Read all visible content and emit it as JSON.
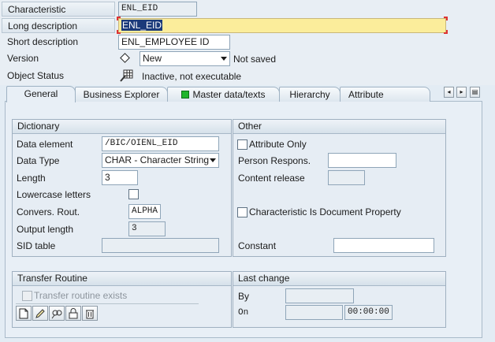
{
  "header": {
    "characteristic": {
      "label": "Characteristic",
      "value": "ENL_EID"
    },
    "long_description": {
      "label": "Long description",
      "value": "ENL_EID"
    },
    "short_description": {
      "label": "Short description",
      "value": "ENL_EMPLOYEE ID"
    },
    "version": {
      "label": "Version",
      "value": "New",
      "status": "Not saved"
    },
    "object_status": {
      "label": "Object Status",
      "value": "Inactive, not executable"
    }
  },
  "tabs": [
    {
      "label": "General",
      "active": true
    },
    {
      "label": "Business Explorer"
    },
    {
      "label": "Master data/texts"
    },
    {
      "label": "Hierarchy"
    },
    {
      "label": "Attribute"
    }
  ],
  "dictionary": {
    "title": "Dictionary",
    "data_element": {
      "label": "Data element",
      "value": "/BIC/OIENL_EID"
    },
    "data_type": {
      "label": "Data Type",
      "value": "CHAR - Character String"
    },
    "length": {
      "label": "Length",
      "value": "3"
    },
    "lowercase": {
      "label": "Lowercase letters",
      "checked": false
    },
    "convers_rout": {
      "label": "Convers. Rout.",
      "value": "ALPHA"
    },
    "output_length": {
      "label": "Output length",
      "value": "3"
    },
    "sid_table": {
      "label": "SID table",
      "value": ""
    }
  },
  "other": {
    "title": "Other",
    "attribute_only": {
      "label": "Attribute Only",
      "checked": false
    },
    "person_respons": {
      "label": "Person Respons.",
      "value": ""
    },
    "content_release": {
      "label": "Content release",
      "value": ""
    },
    "doc_property": {
      "label": "Characteristic Is Document Property",
      "checked": false
    },
    "constant": {
      "label": "Constant",
      "value": ""
    }
  },
  "transfer_routine": {
    "title": "Transfer Routine",
    "exists": {
      "label": "Transfer routine exists",
      "checked": false
    },
    "toolbar": [
      "create-icon",
      "edit-icon",
      "display-icon",
      "lock-icon",
      "delete-icon"
    ]
  },
  "last_change": {
    "title": "Last change",
    "by": {
      "label": "By",
      "value": ""
    },
    "on": {
      "label": "On",
      "date": "",
      "time": "00:00:00"
    }
  },
  "colors": {
    "background": "#e3ecf4",
    "highlight_field": "#fbed9b",
    "selection": "#1b3a7a",
    "status_green": "#1fb52b"
  }
}
